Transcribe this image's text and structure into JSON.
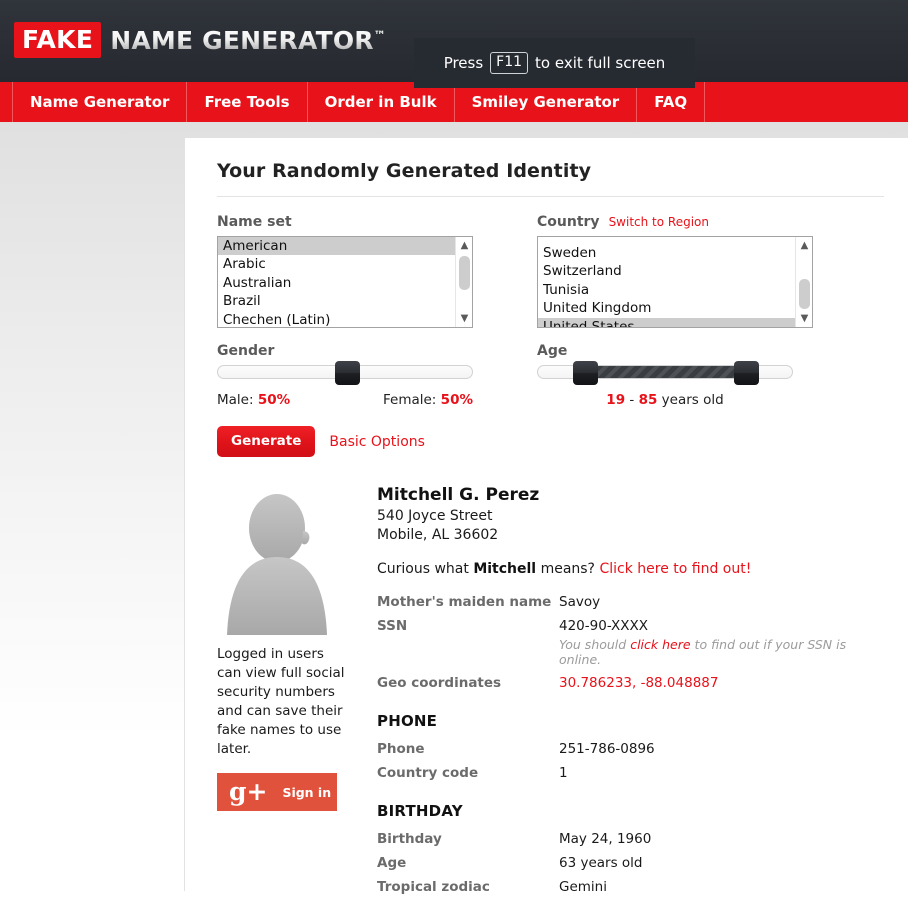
{
  "header": {
    "logo_badge": "FAKE",
    "logo_text": "NAME GENERATOR",
    "logo_tm": "™"
  },
  "fullscreen_tooltip": {
    "prefix": "Press",
    "key": "F11",
    "suffix": "to exit full screen"
  },
  "nav": {
    "items": [
      {
        "label": "Name Generator"
      },
      {
        "label": "Free Tools"
      },
      {
        "label": "Order in Bulk"
      },
      {
        "label": "Smiley Generator"
      },
      {
        "label": "FAQ"
      }
    ]
  },
  "main": {
    "title": "Your Randomly Generated Identity"
  },
  "nameset": {
    "label": "Name set",
    "options": [
      {
        "label": "American",
        "selected": true
      },
      {
        "label": "Arabic",
        "selected": false
      },
      {
        "label": "Australian",
        "selected": false
      },
      {
        "label": "Brazil",
        "selected": false
      },
      {
        "label": "Chechen (Latin)",
        "selected": false
      }
    ],
    "selected": "American"
  },
  "country": {
    "label": "Country",
    "switch_link": "Switch to Region",
    "options": [
      {
        "label": "Sweden",
        "selected": false
      },
      {
        "label": "Switzerland",
        "selected": false
      },
      {
        "label": "Tunisia",
        "selected": false
      },
      {
        "label": "United Kingdom",
        "selected": false
      },
      {
        "label": "United States",
        "selected": true
      }
    ],
    "selected": "United States"
  },
  "gender": {
    "label": "Gender",
    "male_label": "Male:",
    "male_value": "50%",
    "female_label": "Female:",
    "female_value": "50%",
    "handle_percent": 50
  },
  "age": {
    "label": "Age",
    "min": "19",
    "max": "85",
    "separator": "-",
    "suffix": "years old",
    "low_percent": 16,
    "high_percent": 83
  },
  "actions": {
    "generate_label": "Generate",
    "basic_options_label": "Basic Options"
  },
  "sidebar": {
    "note": "Logged in users can view full social security numbers and can save their fake names to use later.",
    "signin_label": "Sign in",
    "gplus_glyph": "g+"
  },
  "identity": {
    "name": "Mitchell G. Perez",
    "street": "540 Joyce Street",
    "city_state_zip": "Mobile, AL 36602",
    "meaning_prefix": "Curious what",
    "meaning_name": "Mitchell",
    "meaning_middle": "means?",
    "meaning_link": "Click here to find out!",
    "fields": [
      {
        "key": "Mother's maiden name",
        "value": "Savoy",
        "red": false
      },
      {
        "key": "SSN",
        "value": "420-90-XXXX",
        "red": false
      },
      {
        "key": "Geo coordinates",
        "value": "30.786233, -88.048887",
        "red": true
      }
    ],
    "ssn_note_prefix": "You should",
    "ssn_note_link": "click here",
    "ssn_note_suffix": "to find out if your SSN is online."
  },
  "phone_section": {
    "heading": "PHONE",
    "fields": [
      {
        "key": "Phone",
        "value": "251-786-0896"
      },
      {
        "key": "Country code",
        "value": "1"
      }
    ]
  },
  "birthday_section": {
    "heading": "BIRTHDAY",
    "fields": [
      {
        "key": "Birthday",
        "value": "May 24, 1960"
      },
      {
        "key": "Age",
        "value": "63 years old"
      },
      {
        "key": "Tropical zodiac",
        "value": "Gemini"
      }
    ]
  },
  "colors": {
    "brand_red": "#e8121a",
    "header_dark": "#2b2f36",
    "tooltip_bg": "#262a31",
    "gplus_orange": "#e0523c",
    "label_gray": "#6b6b6b"
  }
}
